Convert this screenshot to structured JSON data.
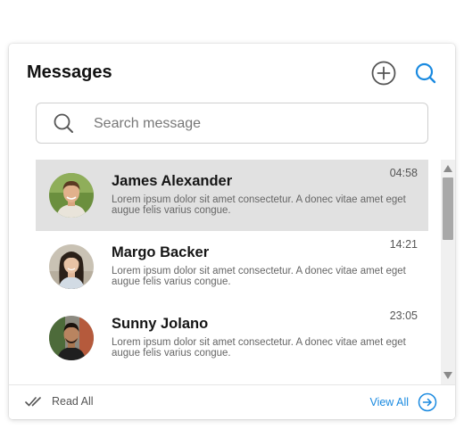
{
  "header": {
    "title": "Messages",
    "add_icon": "plus-circle-icon",
    "search_icon": "search-icon"
  },
  "search": {
    "placeholder": "Search message",
    "value": ""
  },
  "messages": [
    {
      "name": "James Alexander",
      "time": "04:58",
      "preview": "Lorem ipsum dolor sit amet consectetur. A donec vitae amet eget augue felis varius congue.",
      "selected": true
    },
    {
      "name": "Margo Backer",
      "time": "14:21",
      "preview": "Lorem ipsum dolor sit amet consectetur. A donec vitae amet eget augue felis varius congue.",
      "selected": false
    },
    {
      "name": "Sunny Jolano",
      "time": "23:05",
      "preview": "Lorem ipsum dolor sit amet consectetur. A donec vitae amet eget augue felis varius congue.",
      "selected": false
    }
  ],
  "footer": {
    "read_all": "Read All",
    "view_all": "View All"
  },
  "colors": {
    "accent": "#1a8ae0",
    "selected_row": "#e1e1e1"
  }
}
